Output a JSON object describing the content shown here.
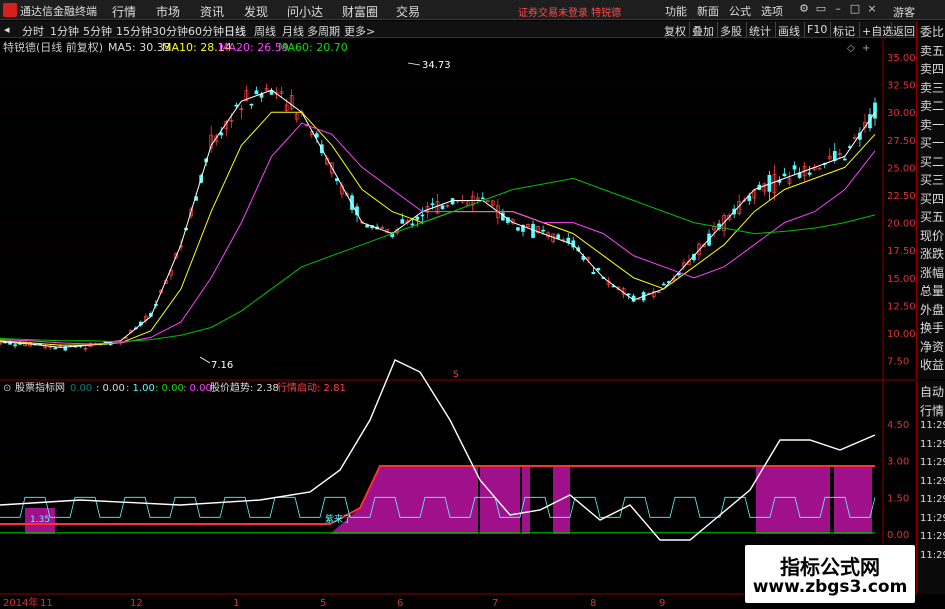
{
  "app": {
    "title": "通达信金融终端"
  },
  "menu": [
    "行情",
    "市场",
    "资讯",
    "发现",
    "问小达",
    "财富圈",
    "交易"
  ],
  "status": "证券交易未登录  特锐德",
  "right_menu": [
    "功能",
    "新面",
    "公式",
    "选项"
  ],
  "guest": "游客",
  "periods": [
    "分时",
    "1分钟",
    "5分钟",
    "15分钟",
    "30分钟",
    "60分钟",
    "日线",
    "周线",
    "月线",
    "多周期",
    "更多>"
  ],
  "active_period": "日线",
  "toolbar_right": [
    "复权",
    "叠加",
    "多股",
    "统计",
    "画线",
    "F10",
    "标记",
    "+自选",
    "返回"
  ],
  "info": {
    "stock": "特锐德(日线 前复权)",
    "ma5": "MA5: 30.33",
    "ma10": "MA10: 28.14",
    "ma20": "MA20: 26.59",
    "ma60": "MA60: 20.70"
  },
  "price_axis": [
    "35.00",
    "32.50",
    "30.00",
    "27.50",
    "25.00",
    "22.50",
    "20.00",
    "17.50",
    "15.00",
    "12.50",
    "10.00",
    "7.50"
  ],
  "indicator_axis": [
    "4.50",
    "3.00",
    "1.50",
    "0.00"
  ],
  "annotations": {
    "high": "34.73",
    "low": "7.16",
    "s_marker": "S",
    "line_a": "1.35",
    "line_b": "紫来了"
  },
  "indicator_info": {
    "name": "股票指标网",
    "v1": "0.00",
    "v2": ": 0.00",
    "v3": ": 1.00",
    "v4": ": 0.00",
    "v5": ": 0.00",
    "trend": "股价趋势: 2.38",
    "start": "行情启动: 2.81"
  },
  "date_axis": [
    "2014年",
    "11",
    "12",
    "1",
    "5",
    "6",
    "7",
    "8",
    "9"
  ],
  "side_panel": [
    "委比",
    "卖五",
    "卖四",
    "卖三",
    "卖二",
    "卖一",
    "买一",
    "买二",
    "买三",
    "买四",
    "买五",
    "现价",
    "涨跌",
    "涨幅",
    "总量",
    "外盘",
    "换手",
    "净资",
    "收益"
  ],
  "side_panel2": [
    "自动",
    "行情",
    "11:29",
    "11:29",
    "11:29",
    "11:29",
    "11:29",
    "11:29",
    "11:29",
    "11:29"
  ],
  "watermark": {
    "title": "指标公式网",
    "url": "www.zbgs3.com"
  },
  "colors": {
    "up": "#ff4040",
    "down": "#54ffff",
    "ma5": "#ffffff",
    "ma10": "#ffff00",
    "ma20": "#ff40ff",
    "ma60": "#00c000",
    "fill": "#a0108a"
  },
  "chart_data": {
    "type": "line",
    "series": [
      {
        "name": "MA5",
        "values": [
          9.2,
          9.0,
          8.7,
          8.9,
          9.3,
          11.5,
          18,
          27,
          31,
          32,
          30,
          25,
          20,
          19,
          21,
          22,
          22,
          20,
          19,
          18,
          15,
          13,
          14,
          17,
          20,
          23,
          24,
          25,
          26,
          30
        ]
      },
      {
        "name": "MA10",
        "values": [
          9.3,
          9.1,
          8.9,
          8.9,
          9.1,
          10.2,
          14,
          21,
          27,
          30,
          30,
          27,
          23,
          21,
          20,
          21,
          21,
          21,
          20,
          19,
          17,
          15,
          14,
          16,
          18,
          21,
          23,
          24,
          25,
          28
        ]
      },
      {
        "name": "MA20",
        "values": [
          9.4,
          9.3,
          9.1,
          9.0,
          9.1,
          9.6,
          11,
          15,
          20,
          26,
          29,
          28,
          25,
          23,
          21,
          21,
          21,
          21,
          20,
          20,
          19,
          17,
          16,
          15,
          16,
          18,
          20,
          21,
          23,
          26.5
        ]
      },
      {
        "name": "MA60",
        "values": [
          9.5,
          9.4,
          9.3,
          9.3,
          9.2,
          9.4,
          9.8,
          10.5,
          12,
          14,
          16,
          17,
          18,
          19,
          20,
          21,
          22,
          23,
          23.5,
          24,
          23,
          22,
          21,
          20,
          19.5,
          19,
          19.2,
          19.5,
          20,
          20.7
        ]
      }
    ],
    "ylim": [
      7.5,
      35
    ]
  }
}
